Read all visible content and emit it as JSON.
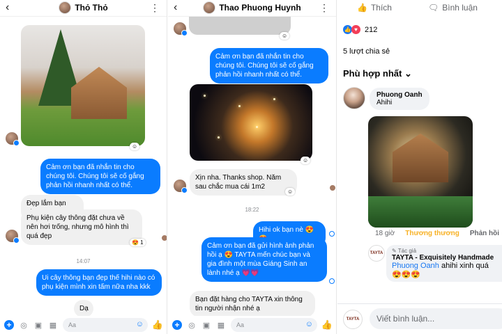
{
  "chat1": {
    "contact_name": "Thỏ Thỏ",
    "messages": {
      "m1": "Cảm ơn bạn đã nhắn tin cho chúng tôi. Chúng tôi sẽ cố gắng phản hồi nhanh nhất có thể.",
      "m2": "Đẹp lắm bạn nha",
      "m3": "Phụ kiện cây thông đặt chưa về nên hơi trống, nhưng mô hình thì quá đẹp",
      "m4": "Ui cây thông bạn đẹp thế hihi nào có phụ kiện mình xin tấm nữa nha kkk",
      "m5": "Dạ"
    },
    "reaction": "😍 1",
    "timestamp": "14:07"
  },
  "chat2": {
    "contact_name": "Thao Phuong Huynh",
    "messages": {
      "m1": "Cảm ơn bạn đã nhắn tin cho chúng tôi. Chúng tôi sẽ cố gắng phản hồi nhanh nhất có thể.",
      "m2": "Xịn nha. Thanks shop. Năm sau chắc mua cái 1m2",
      "m3": "Hihi ok bạn nè 😍😍",
      "m4": "Cảm ơn bạn đã gửi hình ảnh phản hồi ạ 😍 TAYTA mến chúc bạn và gia đình một mùa Giáng Sinh an lành nhé ạ 💗💗",
      "m5": "Bạn đặt hàng cho TAYTA xin thông tin người nhận nhé ạ"
    },
    "timestamp": "18:22"
  },
  "composer": {
    "placeholder": "Aa"
  },
  "facebook": {
    "like_label": "Thích",
    "comment_label": "Bình luận",
    "reaction_count": "212",
    "shares": "5 lượt chia sẻ",
    "sort_label": "Phù hợp nhất",
    "comment": {
      "author": "Phuong Oanh",
      "text": "Ahihi",
      "time": "18 giờ",
      "like_action": "Thương thương",
      "reply_action": "Phản hồi"
    },
    "reply": {
      "author_badge": "Tác giả",
      "page_name": "TAYTA - Exquisitely Handmade",
      "mention": "Phuong Oanh",
      "text": " ahihi xinh quá",
      "emojis": "😍😍😍"
    },
    "page_avatar_text": "TAYTA",
    "comment_placeholder": "Viết bình luận..."
  }
}
